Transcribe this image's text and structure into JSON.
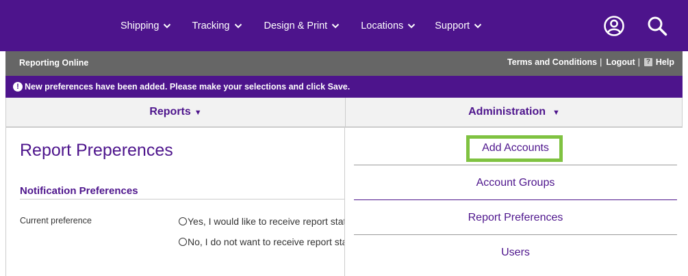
{
  "topnav": {
    "items": [
      {
        "label": "Shipping"
      },
      {
        "label": "Tracking"
      },
      {
        "label": "Design & Print"
      },
      {
        "label": "Locations"
      },
      {
        "label": "Support"
      }
    ],
    "icons": [
      "account-icon",
      "search-icon"
    ]
  },
  "subheader": {
    "app_title": "Reporting Online",
    "terms_label": "Terms and Conditions",
    "logout_label": "Logout",
    "help_label": "Help",
    "help_icon_glyph": "?",
    "separator": "|"
  },
  "notice": {
    "icon_glyph": "!",
    "text": "New preferences have been added. Please make your selections and click Save."
  },
  "tabs": [
    {
      "label": "Reports"
    },
    {
      "label": "Administration"
    }
  ],
  "main": {
    "page_title": "Report Preperences",
    "section_title": "Notification Preferences",
    "pref_label": "Current preference",
    "options": [
      {
        "label": "Yes, I would like to receive report status emails",
        "selected": false
      },
      {
        "label": "No, I do not want to receive report status emails",
        "selected": false
      }
    ]
  },
  "admin_menu": {
    "items": [
      {
        "label": "Add Accounts",
        "highlighted": true
      },
      {
        "label": "Account Groups"
      },
      {
        "label": "Report Preferences"
      },
      {
        "label": "Users"
      }
    ]
  },
  "colors": {
    "brand_purple": "#4d148c",
    "subheader_gray": "#666666",
    "highlight_green": "#7fc241"
  }
}
